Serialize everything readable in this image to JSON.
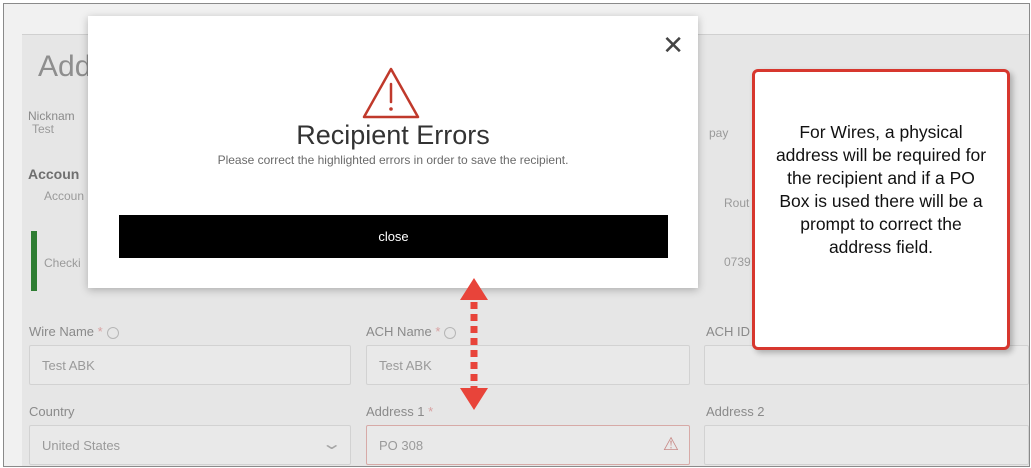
{
  "background_form": {
    "title_partial": "Add",
    "nickname_label": "Nicknam",
    "nickname_value": "Test",
    "account_section": "Accoun",
    "account_sub_label": "Accoun",
    "account_type_partial": "Checki",
    "pay_partial": "pay",
    "routing_partial": "Rout",
    "routing_value_partial": "0739",
    "wire_name_label": "Wire Name",
    "wire_name_value": "Test ABK",
    "ach_name_label": "ACH Name",
    "ach_name_value": "Test ABK",
    "ach_id_label": "ACH ID",
    "country_label": "Country",
    "country_value": "United States",
    "address1_label": "Address 1",
    "address1_value": "PO 308",
    "address2_label": "Address 2",
    "required_mark": "*"
  },
  "modal": {
    "title": "Recipient Errors",
    "subtitle": "Please correct the highlighted errors in order to save the recipient.",
    "close_button_label": "close",
    "close_icon": "close-icon",
    "warning_icon": "warning-triangle-icon"
  },
  "callout": {
    "text": "For Wires, a physical address will be required for the recipient and if a PO Box is used there will be a prompt to correct the address field."
  },
  "colors": {
    "callout_border": "#d7372e",
    "arrow": "#e8443a",
    "warning_icon": "#c0392b",
    "close_button_bg": "#000000"
  }
}
